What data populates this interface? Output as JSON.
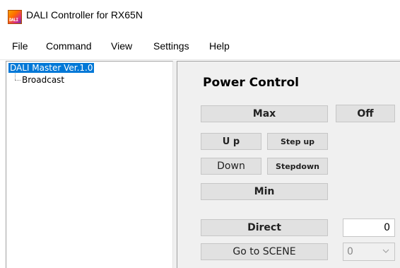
{
  "window": {
    "title": "DALI Controller for RX65N",
    "icon_label": "DALI"
  },
  "menu": [
    "File",
    "Command",
    "View",
    "Settings",
    "Help"
  ],
  "tree": {
    "root": "DALI Master Ver.1.0",
    "children": [
      "Broadcast"
    ]
  },
  "panel": {
    "title": "Power Control",
    "buttons": {
      "max": "Max",
      "off": "Off",
      "up": "U p",
      "step_up": "Step up",
      "down": "Down",
      "step_down": "Stepdown",
      "min": "Min",
      "direct": "Direct",
      "go_to_scene": "Go to SCENE"
    },
    "direct_value": "0",
    "scene_value": "0"
  },
  "colors": {
    "selection": "#0078d7",
    "panel_bg": "#f0f0f0",
    "button_bg": "#e1e1e1"
  }
}
